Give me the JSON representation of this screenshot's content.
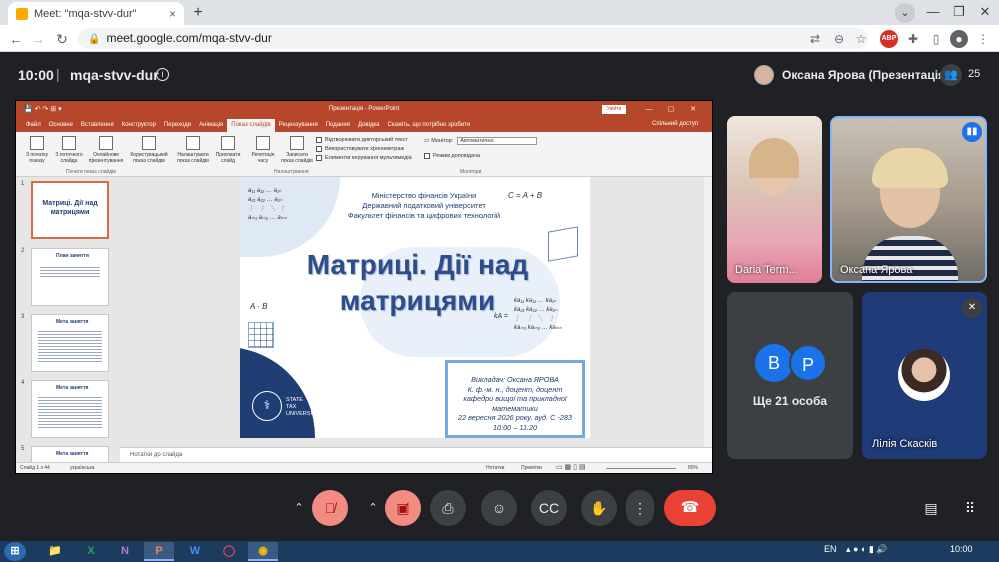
{
  "browser": {
    "tab_title": "Meet: \"mqa-stvv-dur\"",
    "tab_close": "×",
    "new_tab": "+",
    "url": "meet.google.com/mqa-stvv-dur",
    "window_controls": [
      "—",
      "❐",
      "✕"
    ],
    "ext_abp": "ABP"
  },
  "meet": {
    "time": "10:00",
    "separator": "|",
    "code": "mqa-stvv-dur",
    "presenter_label": "Оксана Ярова (Презентація)",
    "participant_count": "25"
  },
  "powerpoint": {
    "title": "Презентація - PowerPoint",
    "sign_in": "Увійти",
    "menu": [
      "Файл",
      "Основне",
      "Вставлення",
      "Конструктор",
      "Переходи",
      "Анімація",
      "Показ слайдів",
      "Рецензування",
      "Подання",
      "Довідка",
      "Скажіть, що потрібно зробити"
    ],
    "active_menu": "Показ слайдів",
    "share": "Спільний доступ",
    "ribbon": {
      "buttons": [
        "З початку показу",
        "З поточного слайда",
        "Онлайнове презентування",
        "Користувацький показ слайдів",
        "Налаштувати показ слайдів",
        "Приховати слайд",
        "Репетиція часу",
        "Записати показ слайдів"
      ],
      "checks": [
        "Відтворювати дикторський текст",
        "Використовувати хронометраж",
        "Елементи керування мультимедіа"
      ],
      "monitor_label": "Монітор:",
      "monitor_value": "Автоматично",
      "presenter_view": "Режим доповідача",
      "group1": "Почати показ слайдів",
      "group2": "Налаштування",
      "group3": "Монітори"
    },
    "thumbnails": [
      {
        "num": "1",
        "text": "Матриці. Дії над матрицями"
      },
      {
        "num": "2",
        "text": "План заняття"
      },
      {
        "num": "3",
        "text": "Мета заняття"
      },
      {
        "num": "4",
        "text": "Мета заняття"
      },
      {
        "num": "5",
        "text": "Мета заняття"
      }
    ],
    "notes_placeholder": "Нотатки до слайда",
    "status_left": "Слайд 1 з 44",
    "status_lang": "українська",
    "status_notes": "Нотатки",
    "status_comments": "Примітки",
    "zoom": "80%"
  },
  "slide": {
    "ministry_lines": [
      "Міністерство фінансів України",
      "Державний податковий університет",
      "Факультет фінансів та цифрових технологій"
    ],
    "title_line1": "Матриці. Дії над",
    "title_line2": "матрицями",
    "formula_c": "C = A + B",
    "formula_ab": "A · B",
    "formula_ka": "kA =",
    "lecturer_lines": [
      "Викладач: Оксана ЯРОВА",
      "К. ф.-м. н., доцент, доцент",
      "кафедри вищої та прикладної",
      "математики",
      "22 вересня 2026 року, ауд. С -283",
      "10:00 – 11:20"
    ],
    "university_lines": [
      "STATE",
      "TAX",
      "UNIVERSITY"
    ]
  },
  "participants": {
    "tile1_name": "Daria Term...",
    "tile2_name": "Оксана Ярова",
    "tile3_more": "Ще 21 особа",
    "tile3_avatars": [
      "В",
      "Р"
    ],
    "tile4_name": "Лілія Скасків"
  },
  "taskbar": {
    "lang": "EN",
    "time": "10:00",
    "apps": [
      "X",
      "N",
      "P",
      "W"
    ]
  },
  "colors": {
    "meet_bg": "#202124",
    "ppt_accent": "#b7472a",
    "leave_red": "#ea4335",
    "mic_off_red": "#f28b82",
    "avatar_blue": "#1a73e8"
  }
}
